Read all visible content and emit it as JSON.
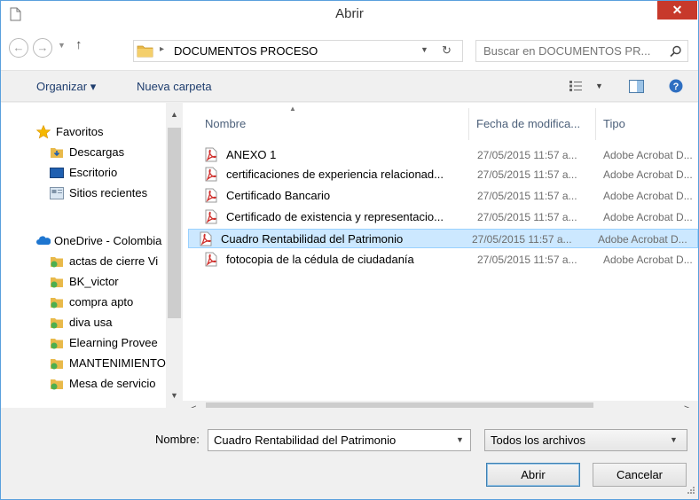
{
  "window": {
    "title": "Abrir",
    "close_glyph": "✕"
  },
  "address": {
    "path": "DOCUMENTOS PROCESO",
    "search_placeholder": "Buscar en DOCUMENTOS PR..."
  },
  "toolbar": {
    "organize": "Organizar ▾",
    "new_folder": "Nueva carpeta"
  },
  "nav": {
    "items": [
      {
        "label": "Favoritos",
        "icon": "star-icon"
      },
      {
        "label": "Descargas",
        "icon": "downloads-folder-icon"
      },
      {
        "label": "Escritorio",
        "icon": "desktop-icon"
      },
      {
        "label": "Sitios recientes",
        "icon": "recent-places-icon"
      },
      {
        "label": "OneDrive - Colombia",
        "icon": "onedrive-cloud-icon"
      },
      {
        "label": "actas de cierre Vi",
        "icon": "synced-folder-icon"
      },
      {
        "label": "BK_victor",
        "icon": "synced-folder-icon"
      },
      {
        "label": "compra apto",
        "icon": "synced-folder-icon"
      },
      {
        "label": "diva usa",
        "icon": "synced-folder-icon"
      },
      {
        "label": "Elearning Provee",
        "icon": "synced-folder-icon"
      },
      {
        "label": "MANTENIMIENTO",
        "icon": "synced-folder-icon"
      },
      {
        "label": "Mesa de servicio",
        "icon": "synced-folder-icon"
      }
    ]
  },
  "columns": {
    "name": "Nombre",
    "date": "Fecha de modifica...",
    "type": "Tipo"
  },
  "files": [
    {
      "name": "ANEXO 1",
      "date": "27/05/2015 11:57 a...",
      "type": "Adobe Acrobat D..."
    },
    {
      "name": "certificaciones de experiencia relacionad...",
      "date": "27/05/2015 11:57 a...",
      "type": "Adobe Acrobat D..."
    },
    {
      "name": "Certificado Bancario",
      "date": "27/05/2015 11:57 a...",
      "type": "Adobe Acrobat D..."
    },
    {
      "name": "Certificado de existencia y representacio...",
      "date": "27/05/2015 11:57 a...",
      "type": "Adobe Acrobat D..."
    },
    {
      "name": "Cuadro Rentabilidad del Patrimonio",
      "date": "27/05/2015 11:57 a...",
      "type": "Adobe Acrobat D..."
    },
    {
      "name": "fotocopia de la cédula de ciudadanía",
      "date": "27/05/2015 11:57 a...",
      "type": "Adobe Acrobat D..."
    }
  ],
  "selected_index": 4,
  "bottom": {
    "name_label": "Nombre:",
    "filename_value": "Cuadro Rentabilidad del Patrimonio",
    "filetype": "Todos los archivos",
    "open": "Abrir",
    "cancel": "Cancelar"
  },
  "colors": {
    "accent": "#5aa0dd",
    "selection": "#cce8ff",
    "close": "#c7392b"
  }
}
